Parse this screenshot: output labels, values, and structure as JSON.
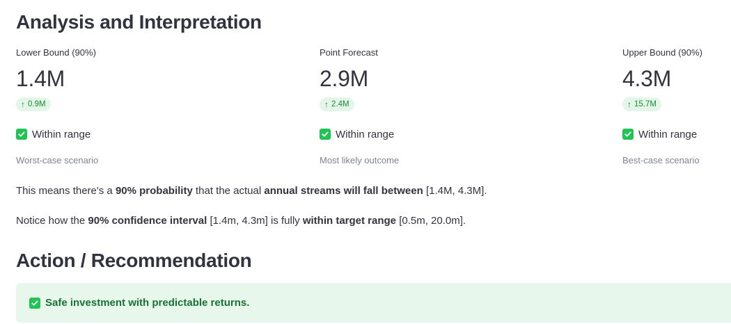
{
  "analysis": {
    "heading": "Analysis and Interpretation",
    "metrics": [
      {
        "label": "Lower Bound (90%)",
        "value": "1.4M",
        "delta": "0.9M",
        "delta_direction": "up",
        "status": "Within range",
        "caption": "Worst-case scenario"
      },
      {
        "label": "Point Forecast",
        "value": "2.9M",
        "delta": "2.4M",
        "delta_direction": "up",
        "status": "Within range",
        "caption": "Most likely outcome"
      },
      {
        "label": "Upper Bound (90%)",
        "value": "4.3M",
        "delta": "15.7M",
        "delta_direction": "up",
        "status": "Within range",
        "caption": "Best-case scenario"
      }
    ],
    "paragraph1": {
      "t1": "This means there's a ",
      "b1": "90% probability",
      "t2": " that the actual ",
      "b2": "annual streams will fall between",
      "t3": " [1.4M, 4.3M]."
    },
    "paragraph2": {
      "t1": "Notice how the ",
      "b1": "90% confidence interval",
      "t2": " [1.4m, 4.3m] is fully ",
      "b2": "within target range",
      "t3": " [0.5m, 20.0m]."
    }
  },
  "action": {
    "heading": "Action / Recommendation",
    "alert_text": "Safe investment with predictable returns."
  },
  "colors": {
    "text": "#31333f",
    "muted": "#808495",
    "delta_bg": "#e3f6e8",
    "delta_fg": "#1e8a3b",
    "check": "#21c354",
    "alert_bg": "#e8f7ec",
    "alert_fg": "#177233"
  },
  "icons": {
    "delta": "arrow-up-icon",
    "status": "check-box-icon",
    "alert": "check-box-icon"
  }
}
